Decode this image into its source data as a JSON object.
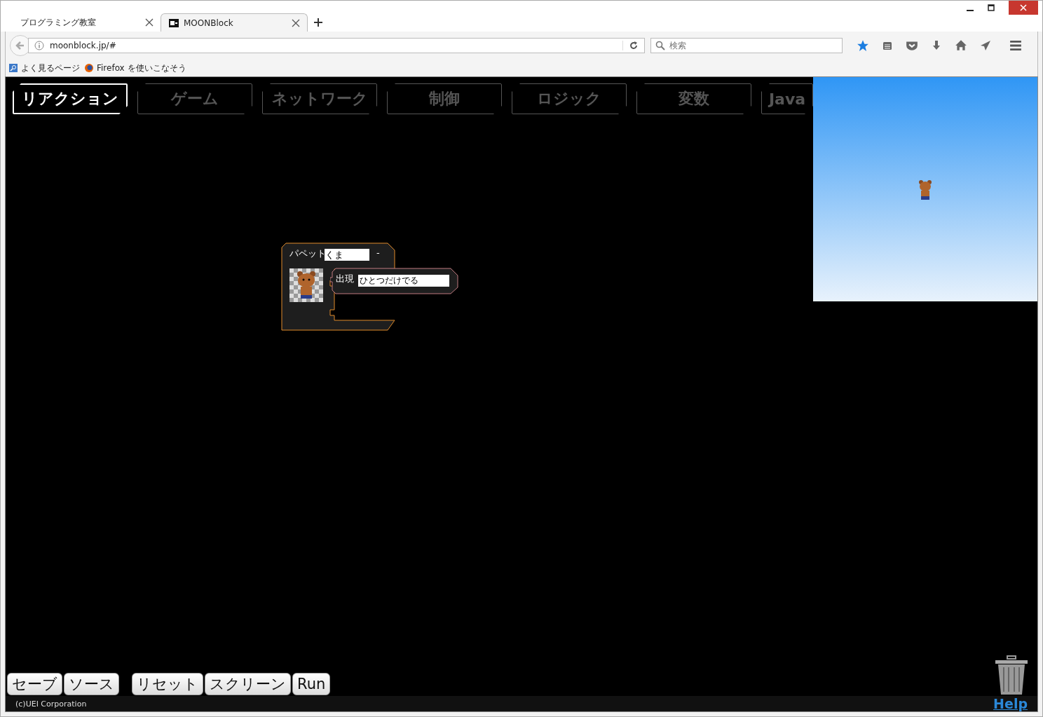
{
  "browser": {
    "tabs": [
      {
        "title": "プログラミング教室",
        "selected": false
      },
      {
        "title": "MOONBlock",
        "selected": true
      }
    ],
    "url": "moonblock.jp/#",
    "search": {
      "placeholder": "検索"
    },
    "bookmarks": [
      "よく見るページ",
      "Firefox を使いこなそう"
    ]
  },
  "categories": [
    {
      "label": "リアクション",
      "selected": true
    },
    {
      "label": "ゲーム",
      "selected": false
    },
    {
      "label": "ネットワーク",
      "selected": false
    },
    {
      "label": "制御",
      "selected": false
    },
    {
      "label": "ロジック",
      "selected": false
    },
    {
      "label": "変数",
      "selected": false
    },
    {
      "label": "Java",
      "selected": false
    }
  ],
  "block": {
    "label": "パペット",
    "name": "くま",
    "collapse": "-",
    "action": {
      "label": "出現",
      "value": "ひとつだけでる"
    }
  },
  "buttons_left": [
    "セーブ",
    "ソース"
  ],
  "buttons_right": [
    "リセット",
    "スクリーン",
    "Run"
  ],
  "footer": {
    "copyright": "(c)UEI Corporation",
    "help": "Help"
  }
}
